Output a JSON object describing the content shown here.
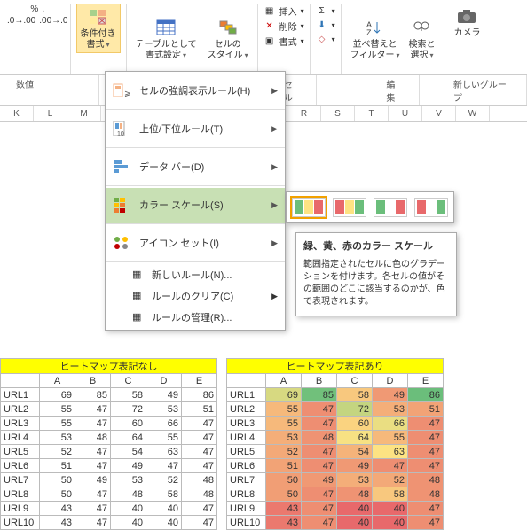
{
  "ribbon": {
    "condfmt": "条件付き\n書式",
    "tablefmt": "テーブルとして\n書式設定",
    "cellstyle": "セルの\nスタイル",
    "insert": "挿入",
    "delete": "削除",
    "format": "書式",
    "sort": "並べ替えと\nフィルター",
    "find": "検索と\n選択",
    "camera": "カメラ"
  },
  "sections": {
    "number": "数値",
    "cell": "セル",
    "edit": "編集",
    "newgroup": "新しいグループ"
  },
  "cols_left": [
    "K",
    "L",
    "M"
  ],
  "cols_right": [
    "R",
    "S",
    "T",
    "U",
    "V",
    "W"
  ],
  "menu": {
    "highlight": "セルの強調表示ルール(H)",
    "toprank": "上位/下位ルール(T)",
    "databar": "データ バー(D)",
    "colorscale": "カラー スケール(S)",
    "iconset": "アイコン セット(I)",
    "newrule": "新しいルール(N)...",
    "clear": "ルールのクリア(C)",
    "manage": "ルールの管理(R)..."
  },
  "tip": {
    "title": "緑、黄、赤のカラー スケール",
    "body": "範囲指定されたセルに色のグラデーションを付けます。各セルの値がその範囲のどこに該当するのかが、色で表現されます。"
  },
  "tableA": {
    "title": "ヒートマップ表記なし",
    "headers": [
      "",
      "A",
      "B",
      "C",
      "D",
      "E"
    ],
    "rows": [
      [
        "URL1",
        69,
        85,
        58,
        49,
        86
      ],
      [
        "URL2",
        55,
        47,
        72,
        53,
        51
      ],
      [
        "URL3",
        55,
        47,
        60,
        66,
        47
      ],
      [
        "URL4",
        53,
        48,
        64,
        55,
        47
      ],
      [
        "URL5",
        52,
        47,
        54,
        63,
        47
      ],
      [
        "URL6",
        51,
        47,
        49,
        47,
        47
      ],
      [
        "URL7",
        50,
        49,
        53,
        52,
        48
      ],
      [
        "URL8",
        50,
        47,
        48,
        58,
        48
      ],
      [
        "URL9",
        43,
        47,
        40,
        40,
        47
      ],
      [
        "URL10",
        43,
        47,
        40,
        40,
        47
      ]
    ]
  },
  "tableB": {
    "title": "ヒートマップ表記あり",
    "headers": [
      "",
      "A",
      "B",
      "C",
      "D",
      "E"
    ],
    "rows": [
      [
        "URL1",
        69,
        85,
        58,
        49,
        86
      ],
      [
        "URL2",
        55,
        47,
        72,
        53,
        51
      ],
      [
        "URL3",
        55,
        47,
        60,
        66,
        47
      ],
      [
        "URL4",
        53,
        48,
        64,
        55,
        47
      ],
      [
        "URL5",
        52,
        47,
        54,
        63,
        47
      ],
      [
        "URL6",
        51,
        47,
        49,
        47,
        47
      ],
      [
        "URL7",
        50,
        49,
        53,
        52,
        48
      ],
      [
        "URL8",
        50,
        47,
        48,
        58,
        48
      ],
      [
        "URL9",
        43,
        47,
        40,
        40,
        47
      ],
      [
        "URL10",
        43,
        47,
        40,
        40,
        47
      ]
    ]
  },
  "chart_data": {
    "type": "table",
    "title": "ヒートマップ表記あり",
    "columns": [
      "A",
      "B",
      "C",
      "D",
      "E"
    ],
    "row_labels": [
      "URL1",
      "URL2",
      "URL3",
      "URL4",
      "URL5",
      "URL6",
      "URL7",
      "URL8",
      "URL9",
      "URL10"
    ],
    "values": [
      [
        69,
        85,
        58,
        49,
        86
      ],
      [
        55,
        47,
        72,
        53,
        51
      ],
      [
        55,
        47,
        60,
        66,
        47
      ],
      [
        53,
        48,
        64,
        55,
        47
      ],
      [
        52,
        47,
        54,
        63,
        47
      ],
      [
        51,
        47,
        49,
        47,
        47
      ],
      [
        50,
        49,
        53,
        52,
        48
      ],
      [
        50,
        47,
        48,
        58,
        48
      ],
      [
        43,
        47,
        40,
        40,
        47
      ],
      [
        43,
        47,
        40,
        40,
        47
      ]
    ],
    "color_scale": {
      "min_color": "#e8696b",
      "mid_color": "#fde383",
      "max_color": "#6bbe7b"
    }
  }
}
